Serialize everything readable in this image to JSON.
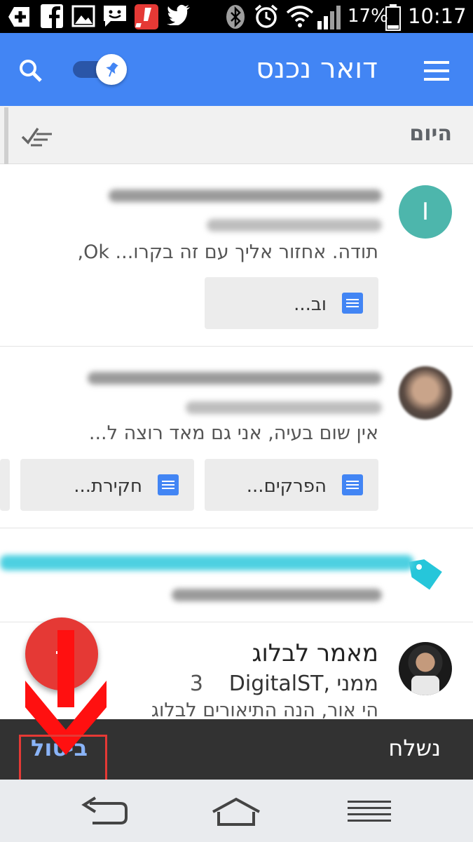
{
  "status_bar": {
    "battery": "17%",
    "time": "10:17",
    "left_icons": [
      "plus-badge-icon",
      "facebook-icon",
      "gallery-icon",
      "messages-icon",
      "alert-app-icon",
      "twitter-icon"
    ],
    "right_icons": [
      "bluetooth-icon",
      "alarm-icon",
      "wifi-icon",
      "signal-icon",
      "battery-icon"
    ]
  },
  "app_bar": {
    "title": "דואר נכנס",
    "color": "#4285f4"
  },
  "section": {
    "label": "היום"
  },
  "emails": [
    {
      "avatar_letter": "I",
      "avatar_color": "#4db6ac",
      "snippet": "תודה. אחזור אליך עם זה בקרו... Ok,",
      "attachments": [
        "וב..."
      ]
    },
    {
      "avatar_letter": "",
      "snippet": "אין שום בעיה, אני גם מאד רוצה ל...",
      "attachments": [
        "הפרקים...",
        "חקירת..."
      ]
    },
    {
      "avatar_letter": "",
      "tag_color": "#26c6da"
    },
    {
      "subject": "מאמר לבלוג",
      "sender": "ממני ,DigitalST",
      "count": "3",
      "snippet": "הי אור, הנה התיאורים לבלוג"
    }
  ],
  "fab": {
    "color": "#e53935"
  },
  "snackbar": {
    "message": "נשלח",
    "action": "ביטול"
  },
  "annotation": {
    "arrow_color": "#ff0000"
  },
  "nav_bar": {
    "buttons": [
      "back-icon",
      "home-icon",
      "menu-icon"
    ]
  }
}
